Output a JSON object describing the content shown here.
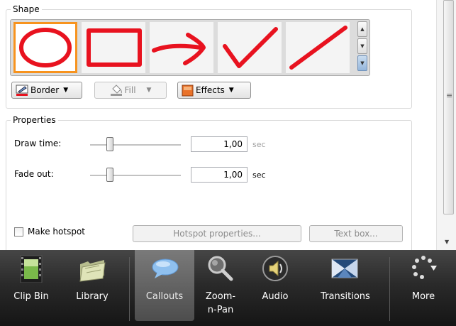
{
  "shape_group": {
    "legend": "Shape",
    "shapes": [
      {
        "name": "ellipse",
        "selected": true
      },
      {
        "name": "rectangle",
        "selected": false
      },
      {
        "name": "arrow",
        "selected": false
      },
      {
        "name": "checkmark",
        "selected": false
      },
      {
        "name": "line",
        "selected": false
      }
    ],
    "shape_stroke_color": "#e8121f",
    "selection_color": "#f7931e",
    "border_label": "Border",
    "fill_label": "Fill",
    "effects_label": "Effects"
  },
  "properties": {
    "legend": "Properties",
    "draw_time": {
      "label": "Draw time:",
      "value": "1,00",
      "unit": "sec"
    },
    "fade_out": {
      "label": "Fade out:",
      "value": "1,00",
      "unit": "sec"
    },
    "make_hotspot": {
      "label": "Make hotspot",
      "checked": false
    },
    "hotspot_properties_label": "Hotspot properties...",
    "text_box_label": "Text box..."
  },
  "tabs": [
    {
      "label": "Clip Bin",
      "icon": "film-strip-icon",
      "active": false
    },
    {
      "label": "Library",
      "icon": "folder-icon",
      "active": false
    },
    {
      "label": "Callouts",
      "icon": "speech-bubble-icon",
      "active": true
    },
    {
      "label": "Zoom-n-Pan",
      "icon": "magnifier-icon",
      "active": false
    },
    {
      "label": "Audio",
      "icon": "speaker-icon",
      "active": false
    },
    {
      "label": "Transitions",
      "icon": "transition-icon",
      "active": false
    },
    {
      "label": "More",
      "icon": "more-dots-icon",
      "active": false
    }
  ]
}
